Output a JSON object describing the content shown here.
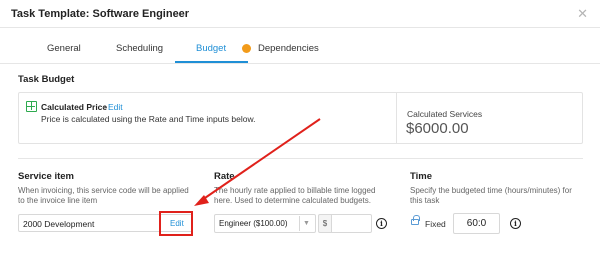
{
  "header": {
    "title": "Task Template: Software Engineer",
    "close_icon": "close-icon"
  },
  "tabs": [
    {
      "label": "General"
    },
    {
      "label": "Scheduling"
    },
    {
      "label": "Budget",
      "active": true
    },
    {
      "label": "Dependencies",
      "indicator_color": "#f29b1a"
    }
  ],
  "task_budget": {
    "title": "Task Budget",
    "calculated_price_label": "Calculated Price",
    "separator": "•",
    "edit_label": "Edit",
    "description": "Price is calculated using the Rate and Time inputs below.",
    "calculated_services_label": "Calculated Services",
    "calculated_services_value": "$6000.00",
    "icon": "calculator-icon"
  },
  "service_item": {
    "title": "Service item",
    "description_line1": "When invoicing, this service code will be applied",
    "description_line2": "to the invoice line item",
    "value": "2000 Development",
    "edit_label": "Edit"
  },
  "rate": {
    "title": "Rate",
    "description_line1": "The hourly rate applied to billable time logged",
    "description_line2": "here. Used to determine calculated budgets.",
    "selected": "Engineer ($100.00)",
    "currency_symbol": "$",
    "amount": ""
  },
  "time": {
    "title": "Time",
    "description_line1": "Specify the budgeted time (hours/minutes) for",
    "description_line2": "this task",
    "lock_label": "Fixed",
    "value": "60:0"
  },
  "colors": {
    "accent": "#1f8fd6",
    "highlight": "#e0211b",
    "indicator": "#f29b1a"
  }
}
